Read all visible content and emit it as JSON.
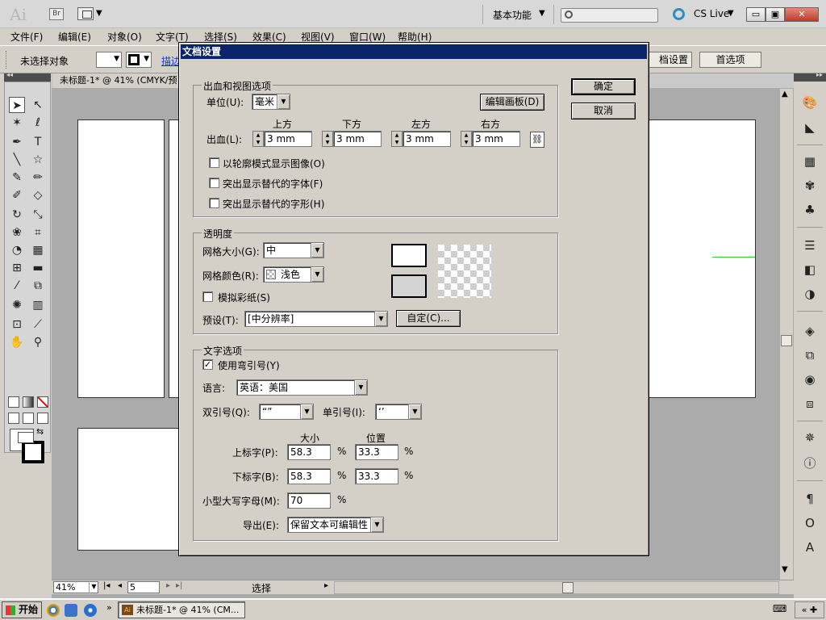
{
  "app": {
    "logo": "Ai",
    "bridge_label": "Br",
    "workspace": "基本功能",
    "cs_live": "CS Live",
    "minimize": "▭",
    "maximize": "▣",
    "close": "✕"
  },
  "menu": [
    "文件(F)",
    "编辑(E)",
    "对象(O)",
    "文字(T)",
    "选择(S)",
    "效果(C)",
    "视图(V)",
    "窗口(W)",
    "帮助(H)"
  ],
  "control_bar": {
    "selection_status": "未选择对象",
    "stroke_link": "描边",
    "doc_setup_button": "档设置",
    "preferences_button": "首选项"
  },
  "document_tab": {
    "title": "未标题-1* @ 41% (CMYK/预"
  },
  "status_bar": {
    "zoom": "41%",
    "page": "5",
    "status_text": "选择"
  },
  "taskbar": {
    "start": "开始",
    "task": "未标题-1* @ 41% (CM..."
  },
  "dialog": {
    "title": "文档设置",
    "ok": "确定",
    "cancel": "取消",
    "bleed_section": {
      "title": "出血和视图选项",
      "unit_label": "单位(U):",
      "unit_value": "毫米",
      "edit_artboards": "编辑画板(D)",
      "bleed_label": "出血(L):",
      "top_label": "上方",
      "bottom_label": "下方",
      "left_label": "左方",
      "right_label": "右方",
      "top_value": "3 mm",
      "bottom_value": "3 mm",
      "left_value": "3 mm",
      "right_value": "3 mm",
      "options": [
        {
          "label": "以轮廓模式显示图像(O)",
          "checked": false
        },
        {
          "label": "突出显示替代的字体(F)",
          "checked": false
        },
        {
          "label": "突出显示替代的字形(H)",
          "checked": false
        }
      ]
    },
    "transparency": {
      "title": "透明度",
      "grid_size_label": "网格大小(G):",
      "grid_size_value": "中",
      "grid_color_label": "网格颜色(R):",
      "grid_color_value": "浅色",
      "simulate_paper": "模拟彩纸(S)",
      "preset_label": "预设(T):",
      "preset_value": "[中分辨率]",
      "custom_button": "自定(C)..."
    },
    "type_options": {
      "title": "文字选项",
      "use_typographer_quotes": "使用弯引号(Y)",
      "language_label": "语言:",
      "language_value": "英语：美国",
      "double_quotes_label": "双引号(Q):",
      "double_quotes_value": "“”",
      "single_quotes_label": "单引号(I):",
      "single_quotes_value": "‘’",
      "size_header": "大小",
      "position_header": "位置",
      "superscript_label": "上标字(P):",
      "superscript_size": "58.3",
      "superscript_position": "33.3",
      "subscript_label": "下标字(B):",
      "subscript_size": "58.3",
      "subscript_position": "33.3",
      "small_caps_label": "小型大写字母(M):",
      "small_caps_value": "70",
      "percent": "%",
      "export_label": "导出(E):",
      "export_value": "保留文本可编辑性"
    }
  }
}
